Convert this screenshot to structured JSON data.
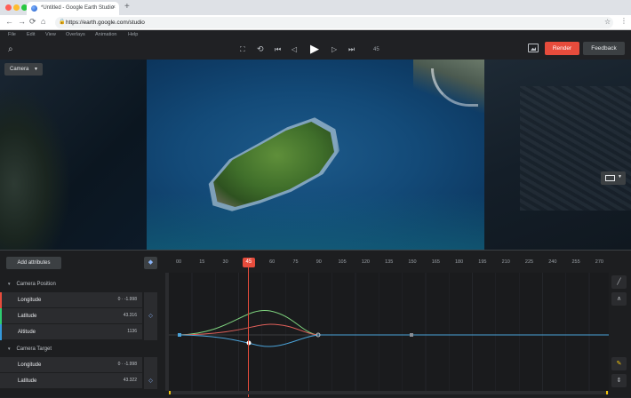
{
  "browser": {
    "tab_title": "*Untitled - Google Earth Studio",
    "url": "https://earth.google.com/studio",
    "tab_close": "×",
    "new_tab": "+",
    "back": "←",
    "forward": "→",
    "reload": "⟳",
    "home": "⌂",
    "lock": "🔒",
    "bookmark": "☆",
    "menu": "⋮",
    "traffic_colors": [
      "#ff5f57",
      "#febc2e",
      "#28c840"
    ]
  },
  "menu": {
    "items": [
      "File",
      "Edit",
      "View",
      "Overlays",
      "Animation",
      "Help"
    ]
  },
  "toolbar": {
    "search_icon": "⌕",
    "fullscreen_icon": "⛶",
    "loop_icon": "⟲",
    "skip_start_icon": "⏮",
    "step_back_icon": "◁",
    "play_icon": "▶",
    "step_forward_icon": "▷",
    "skip_end_icon": "⏭",
    "current_frame": "45",
    "render_label": "Render",
    "feedback_label": "Feedback",
    "render_color": "#e74c3c"
  },
  "viewport": {
    "camera_label": "Camera",
    "caret": "▼"
  },
  "timeline": {
    "add_attributes_label": "Add attributes",
    "keyframe_toggle_icon": "◆",
    "ticks": [
      "00",
      "15",
      "30",
      "45",
      "60",
      "75",
      "90",
      "105",
      "120",
      "135",
      "150",
      "165",
      "180",
      "195",
      "210",
      "225",
      "240",
      "255",
      "270"
    ],
    "playhead": "45",
    "playhead_index": 3,
    "groups": [
      {
        "name": "Camera Position",
        "collapse_icon": "▼",
        "rows": [
          {
            "name": "Longitude",
            "value": "0 · -1.998",
            "stripe": "#e74c3c",
            "keyframe": ""
          },
          {
            "name": "Latitude",
            "value": "43.316",
            "stripe": "#2ecc71",
            "keyframe": "◇"
          },
          {
            "name": "Altitude",
            "value": "1136",
            "stripe": "#3498db",
            "keyframe": ""
          }
        ]
      },
      {
        "name": "Camera Target",
        "collapse_icon": "▼",
        "rows": [
          {
            "name": "Longitude",
            "value": "0 · -1.998",
            "stripe": "",
            "keyframe": ""
          },
          {
            "name": "Latitude",
            "value": "43.322",
            "stripe": "",
            "keyframe": "◇"
          }
        ]
      }
    ],
    "tools": {
      "straight_icon": "╱",
      "ease_icon": "∧",
      "pen_icon": "✎",
      "zoom_icon": "⇕"
    },
    "curve_colors": {
      "green": "#7fd47f",
      "red": "#e0605a",
      "blue": "#4ba3d9"
    }
  }
}
